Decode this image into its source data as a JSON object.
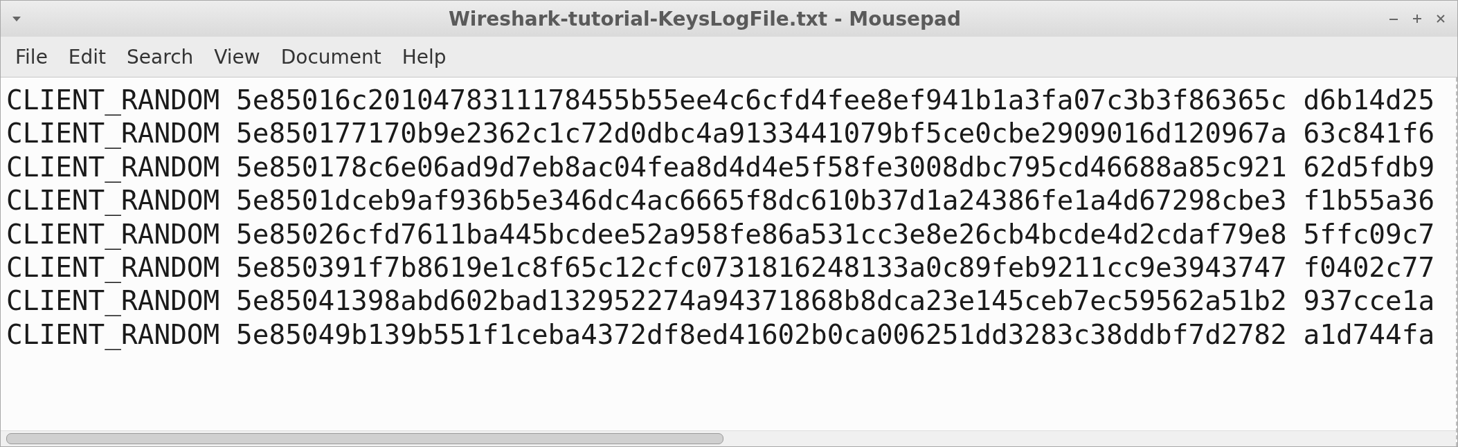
{
  "window": {
    "title": "Wireshark-tutorial-KeysLogFile.txt - Mousepad"
  },
  "menu": [
    "File",
    "Edit",
    "Search",
    "View",
    "Document",
    "Help"
  ],
  "lines": [
    "CLIENT_RANDOM 5e85016c2010478311178455b55ee4c6cfd4fee8ef941b1a3fa07c3b3f86365c d6b14d25",
    "CLIENT_RANDOM 5e850177170b9e2362c1c72d0dbc4a9133441079bf5ce0cbe2909016d120967a 63c841f6",
    "CLIENT_RANDOM 5e850178c6e06ad9d7eb8ac04fea8d4d4e5f58fe3008dbc795cd46688a85c921 62d5fdb9",
    "CLIENT_RANDOM 5e8501dceb9af936b5e346dc4ac6665f8dc610b37d1a24386fe1a4d67298cbe3 f1b55a36",
    "CLIENT_RANDOM 5e85026cfd7611ba445bcdee52a958fe86a531cc3e8e26cb4bcde4d2cdaf79e8 5ffc09c7",
    "CLIENT_RANDOM 5e850391f7b8619e1c8f65c12cfc0731816248133a0c89feb9211cc9e3943747 f0402c77",
    "CLIENT_RANDOM 5e85041398abd602bad132952274a94371868b8dca23e145ceb7ec59562a51b2 937cce1a",
    "CLIENT_RANDOM 5e85049b139b551f1ceba4372df8ed41602b0ca006251dd3283c38ddbf7d2782 a1d744fa"
  ]
}
